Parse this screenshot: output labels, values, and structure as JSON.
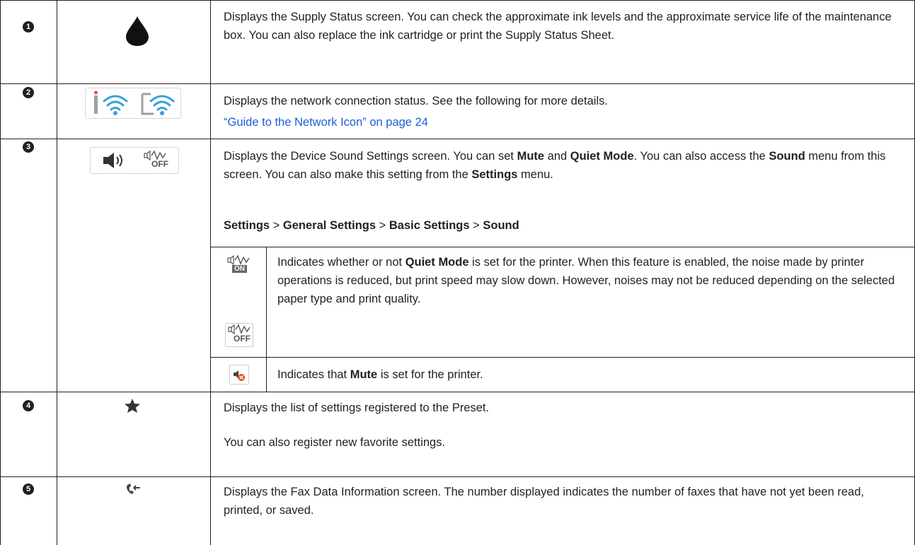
{
  "rows": [
    {
      "number": "1",
      "icon": "ink-drop-icon",
      "text": "Displays the Supply Status screen. You can check the approximate ink levels and the approximate service life of the maintenance box. You can also replace the ink cartridge or print the Supply Status Sheet."
    },
    {
      "number": "2",
      "icon": "network-status-icons",
      "text": "Displays the network connection status. See the following for more details.",
      "link": "“Guide to the Network Icon” on page 24"
    },
    {
      "number": "3",
      "icon": "sound-settings-icons",
      "intro": {
        "t1": "Displays the Device Sound Settings screen. You can set ",
        "b1": "Mute",
        "t2": " and ",
        "b2": "Quiet Mode",
        "t3": ". You can also access the ",
        "b3": "Sound",
        "t4": " menu from this screen. You can also make this setting from the ",
        "b4": "Settings",
        "t5": " menu."
      },
      "path": {
        "p1": "Settings",
        "sep": " > ",
        "p2": "General Settings",
        "p3": "Basic Settings",
        "p4": "Sound"
      },
      "sub": [
        {
          "icon": "quiet-mode-icons",
          "on_label": "ON",
          "off_label": "OFF",
          "t1": "Indicates whether or not ",
          "b1": "Quiet Mode",
          "t2": " is set for the printer. When this feature is enabled, the noise made by printer operations is reduced, but print speed may slow down. However, noises may not be reduced depending on the selected paper type and print quality."
        },
        {
          "icon": "mute-icon",
          "t1": "Indicates that ",
          "b1": "Mute",
          "t2": " is set for the printer."
        }
      ],
      "off_label": "OFF"
    },
    {
      "number": "4",
      "icon": "star-icon",
      "text": "Displays the list of settings registered to the Preset.",
      "text2": "You can also register new favorite settings."
    },
    {
      "number": "5",
      "icon": "fax-data-icon",
      "text": "Displays the Fax Data Information screen. The number displayed indicates the number of faxes that have not yet been read, printed, or saved."
    }
  ],
  "colors": {
    "border": "#231f20",
    "link": "#1a5fd6",
    "wifi": "#3aa0d8",
    "mute_badge": "#e8461e"
  }
}
